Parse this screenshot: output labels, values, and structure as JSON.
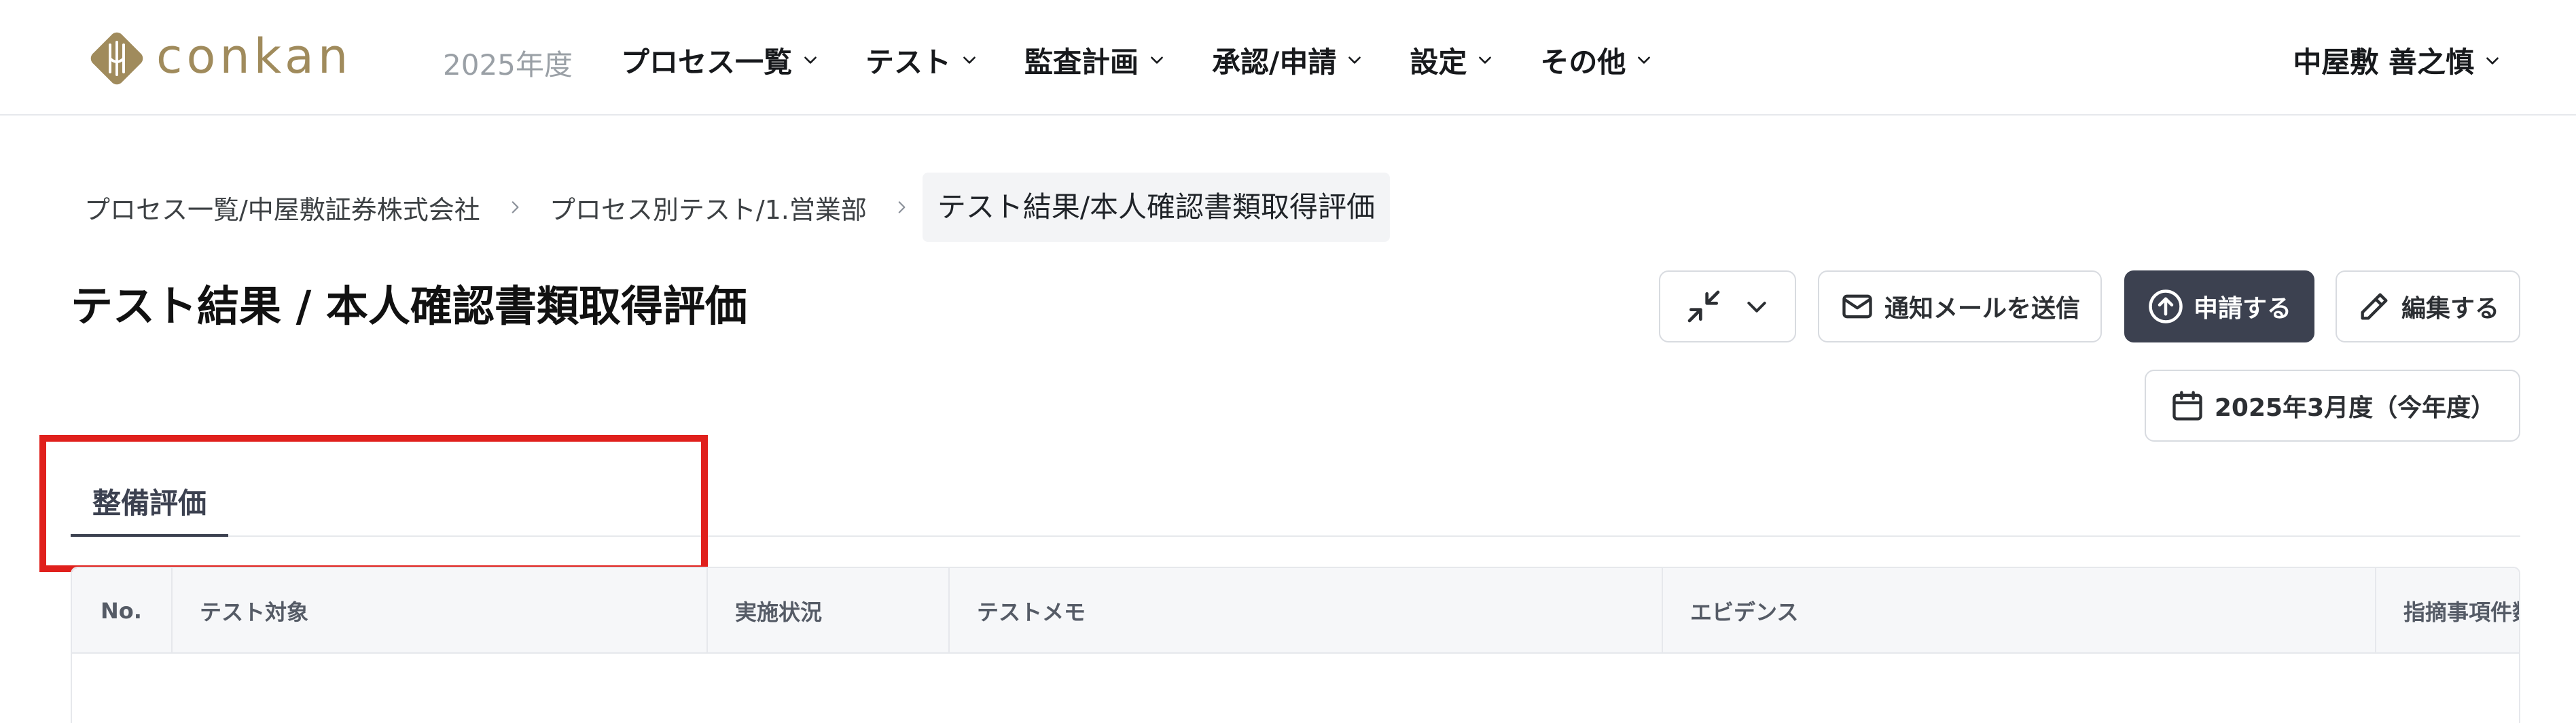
{
  "header": {
    "logo_text": "conkan",
    "fiscal_year": "2025年度",
    "nav": [
      {
        "label": "プロセス一覧"
      },
      {
        "label": "テスト"
      },
      {
        "label": "監査計画"
      },
      {
        "label": "承認/申請"
      },
      {
        "label": "設定"
      },
      {
        "label": "その他"
      }
    ],
    "user_name": "中屋敷 善之慎"
  },
  "breadcrumb": [
    {
      "label": "プロセス一覧/中屋敷証券株式会社"
    },
    {
      "label": "プロセス別テスト/1.営業部"
    },
    {
      "label": "テスト結果/本人確認書類取得評価"
    }
  ],
  "page": {
    "title": "テスト結果 / 本人確認書類取得評価"
  },
  "actions": {
    "send_mail": "通知メールを送信",
    "apply": "申請する",
    "edit": "編集する",
    "period": "2025年3月度（今年度）"
  },
  "tabs": [
    {
      "label": "整備評価",
      "active": true
    }
  ],
  "table": {
    "columns": [
      "No.",
      "テスト対象",
      "実施状況",
      "テストメモ",
      "エビデンス",
      "指摘事項件数"
    ]
  },
  "colors": {
    "brand_gold": "#a08b5c",
    "primary_button": "#3c4150",
    "highlight": "#e0201c"
  }
}
